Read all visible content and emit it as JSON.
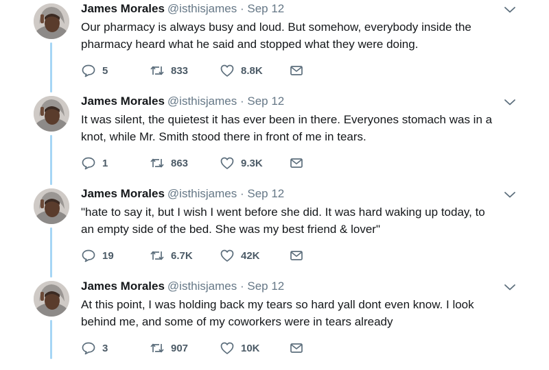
{
  "colors": {
    "thread_line": "#a6d6f5",
    "icon": "#5c6e7c",
    "meta_text": "#657786"
  },
  "icons": {
    "reply": "reply-icon",
    "retweet": "retweet-icon",
    "like": "like-icon",
    "message": "direct-message-icon",
    "caret": "chevron-down-icon"
  },
  "tweets": [
    {
      "name": "James Morales",
      "meta": "@isthisjames · Sep 12",
      "text": "Our pharmacy is always busy and loud. But somehow, everybody inside the pharmacy heard what he said and stopped what they were doing.",
      "replies": "5",
      "retweets": "833",
      "likes": "8.8K"
    },
    {
      "name": "James Morales",
      "meta": "@isthisjames · Sep 12",
      "text": "It was silent, the quietest it has ever been in there. Everyones stomach was in a knot, while Mr. Smith stood there in front of me in tears.",
      "replies": "1",
      "retweets": "863",
      "likes": "9.3K"
    },
    {
      "name": "James Morales",
      "meta": "@isthisjames · Sep 12",
      "text": "\"hate to say it, but I wish I went before she did. It was hard waking up today, to an empty side of the bed. She was my best friend & lover\"",
      "replies": "19",
      "retweets": "6.7K",
      "likes": "42K"
    },
    {
      "name": "James Morales",
      "meta": "@isthisjames · Sep 12",
      "text": "At this point, I was holding back my tears so hard yall dont even know. I look behind me, and some of my coworkers were in tears already",
      "replies": "3",
      "retweets": "907",
      "likes": "10K"
    }
  ]
}
